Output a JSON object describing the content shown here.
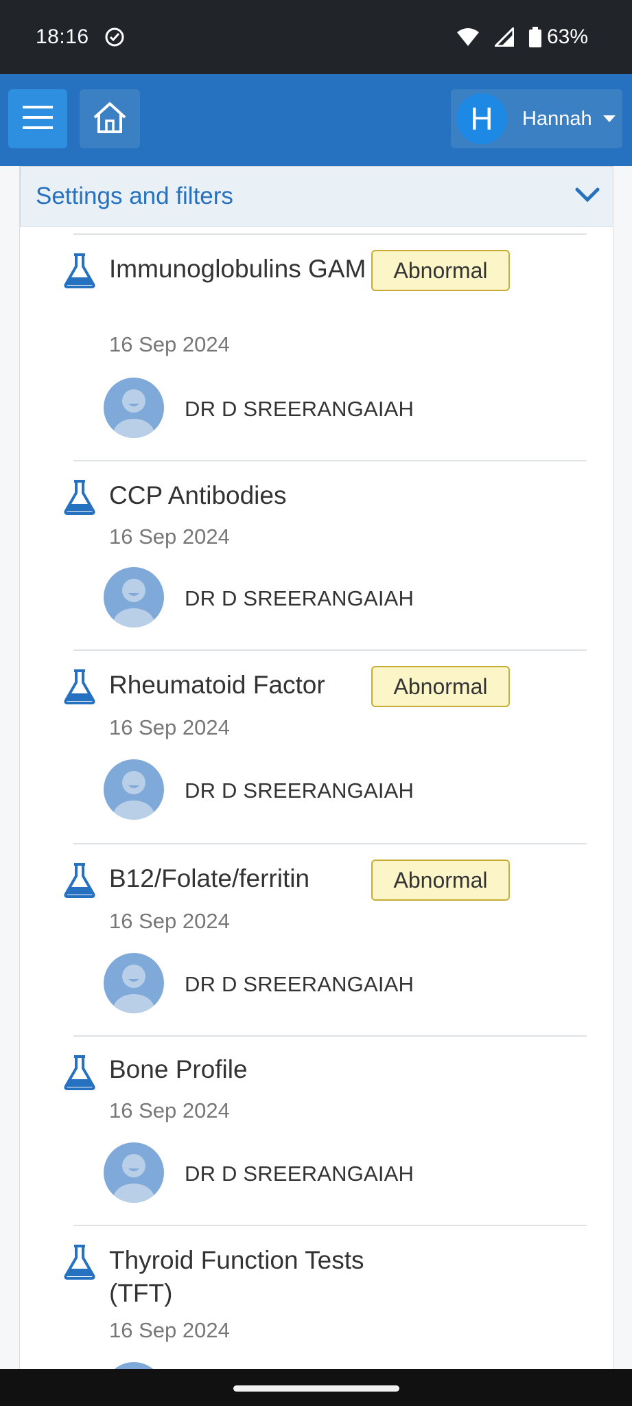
{
  "status_bar": {
    "time": "18:16",
    "battery": "63%"
  },
  "header": {
    "user_initial": "H",
    "user_name": "Hannah"
  },
  "settings": {
    "title": "Settings and filters"
  },
  "results": [
    {
      "name": "Immunoglobulins GAM",
      "badge": "Abnormal",
      "date": "16 Sep 2024",
      "doctor": "DR D SREERANGAIAH"
    },
    {
      "name": "CCP Antibodies",
      "badge": "",
      "date": "16 Sep 2024",
      "doctor": "DR D SREERANGAIAH"
    },
    {
      "name": "Rheumatoid Factor",
      "badge": "Abnormal",
      "date": "16 Sep 2024",
      "doctor": "DR D SREERANGAIAH"
    },
    {
      "name": "B12/Folate/ferritin",
      "badge": "Abnormal",
      "date": "16 Sep 2024",
      "doctor": "DR D SREERANGAIAH"
    },
    {
      "name": "Bone Profile",
      "badge": "",
      "date": "16 Sep 2024",
      "doctor": "DR D SREERANGAIAH"
    },
    {
      "name": "Thyroid Function Tests (TFT)",
      "badge": "",
      "date": "16 Sep 2024",
      "doctor": ""
    }
  ],
  "colors": {
    "header_blue": "#2672c0",
    "accent_blue": "#2e8fe0",
    "badge_bg": "#fbf5c8",
    "badge_border": "#c8ad35"
  }
}
